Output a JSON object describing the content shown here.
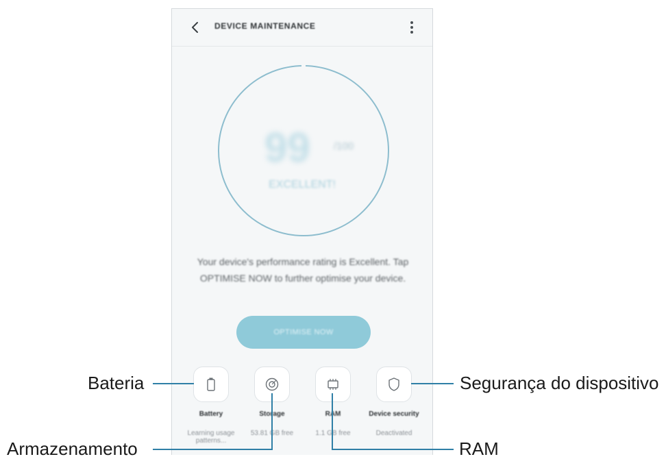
{
  "header": {
    "title": "DEVICE MAINTENANCE",
    "back_icon": "chevron-left-icon",
    "more_icon": "more-vertical-icon"
  },
  "score": {
    "value": "99",
    "unit": "/100",
    "status": "EXCELLENT!"
  },
  "message": "Your device's performance rating is Excellent. Tap OPTIMISE NOW to further optimise your device.",
  "optimise_button": {
    "label": "OPTIMISE NOW"
  },
  "tiles": [
    {
      "label": "Battery",
      "sub": "Learning usage patterns...",
      "icon": "battery-icon"
    },
    {
      "label": "Storage",
      "sub": "53.81 GB free",
      "icon": "storage-icon"
    },
    {
      "label": "RAM",
      "sub": "1.1 GB free",
      "icon": "memory-chip-icon"
    },
    {
      "label": "Device security",
      "sub": "Deactivated",
      "icon": "shield-icon"
    }
  ],
  "callouts": {
    "battery": "Bateria",
    "storage": "Armazenamento",
    "ram": "RAM",
    "security": "Segurança do dispositivo"
  },
  "colors": {
    "accent": "#8fcad9",
    "ring": "#8dbdce",
    "callout_line": "#2f7fa6"
  }
}
